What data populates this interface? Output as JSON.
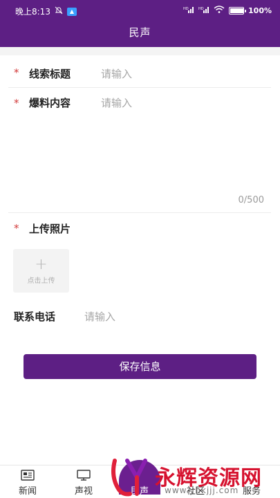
{
  "status_bar": {
    "time": "晚上8:13",
    "battery_text": "100%",
    "battery_level": 1.0,
    "icons": [
      "mute-bell-icon",
      "app-notification-icon",
      "signal-hd-icon",
      "signal-hd-icon",
      "wifi-icon",
      "battery-icon"
    ]
  },
  "header": {
    "title": "民声"
  },
  "form": {
    "title_field": {
      "required_mark": "*",
      "label": "线索标题",
      "placeholder": "请输入"
    },
    "content_field": {
      "required_mark": "*",
      "label": "爆料内容",
      "placeholder": "请输入",
      "counter": "0/500"
    },
    "photo_field": {
      "required_mark": "*",
      "label": "上传照片",
      "upload_plus": "+",
      "upload_text": "点击上传"
    },
    "phone_field": {
      "label": "联系电话",
      "placeholder": "请输入"
    },
    "save_label": "保存信息"
  },
  "tabbar": {
    "tabs": [
      {
        "label": "新闻",
        "icon": "newspaper-icon"
      },
      {
        "label": "声视",
        "icon": "tv-icon"
      },
      {
        "label": "民声",
        "icon": "voice-icon"
      },
      {
        "label": "社区",
        "icon": "community-icon"
      },
      {
        "label": "服务",
        "icon": "service-icon"
      }
    ]
  },
  "watermark": {
    "title": "永辉资源网",
    "url": "www.yhkjjj.com"
  },
  "colors": {
    "brand": "#5d1f84",
    "required": "#d23b3b",
    "watermark": "#d6122f"
  }
}
